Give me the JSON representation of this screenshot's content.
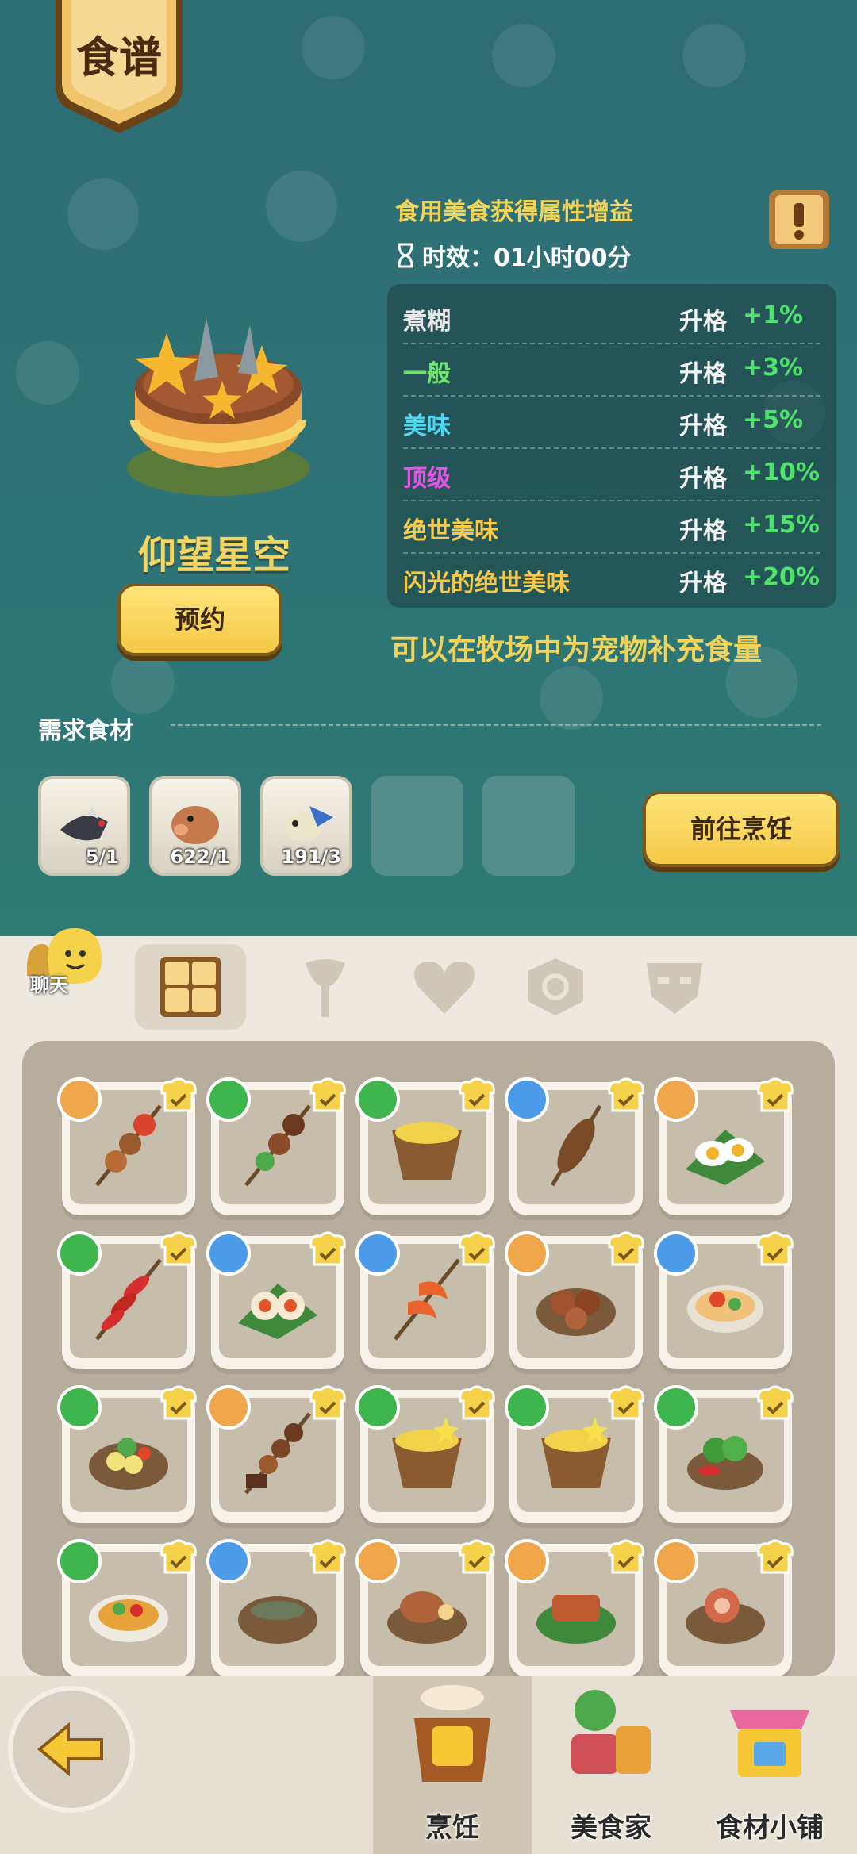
{
  "header": {
    "title": "食谱"
  },
  "info": {
    "title": "食用美食获得属性增益",
    "timer_label": "时效：01小时00分"
  },
  "qualities": [
    {
      "name": "煮糊",
      "label": "升格",
      "value": "+1%",
      "color": "#e8e8e8"
    },
    {
      "name": "一般",
      "label": "升格",
      "value": "+3%",
      "color": "#6ee56a"
    },
    {
      "name": "美味",
      "label": "升格",
      "value": "+5%",
      "color": "#4fd6f0"
    },
    {
      "name": "顶级",
      "label": "升格",
      "value": "+10%",
      "color": "#e652e6"
    },
    {
      "name": "绝世美味",
      "label": "升格",
      "value": "+15%",
      "color": "#f6c94a"
    },
    {
      "name": "闪光的绝世美味",
      "label": "升格",
      "value": "+20%",
      "color": "#f6c94a"
    }
  ],
  "feed_hint": "可以在牧场中为宠物补充食量",
  "dish": {
    "name": "仰望星空",
    "reserve_label": "预约"
  },
  "ingredients": {
    "label": "需求食材",
    "goto_label": "前往烹饪",
    "items": [
      {
        "icon": "fish-bone-icon",
        "count": "5/1"
      },
      {
        "icon": "pig-icon",
        "count": "622/1"
      },
      {
        "icon": "flying-fish-icon",
        "count": "191/3"
      }
    ]
  },
  "chat": {
    "label": "聊天"
  },
  "bottom_tabs": [
    {
      "label": "烹饪",
      "active": true
    },
    {
      "label": "美食家",
      "active": false
    },
    {
      "label": "食材小铺",
      "active": false
    }
  ],
  "colors": {
    "accent_yellow": "#f3d562",
    "green": "#4ee36a",
    "bg_teal": "#2e7376"
  }
}
